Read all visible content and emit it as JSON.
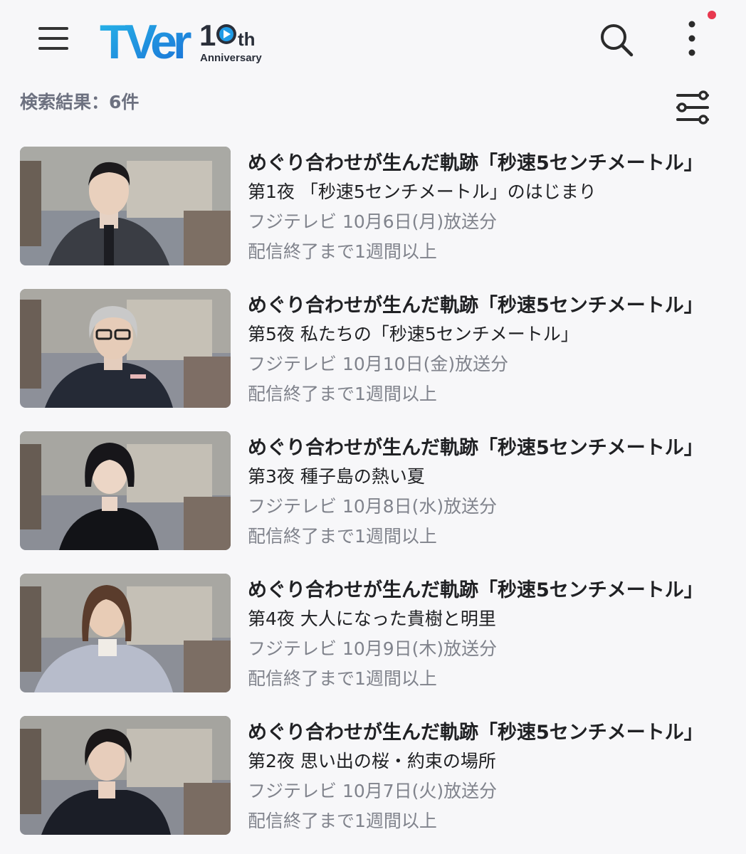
{
  "header": {
    "logo_text": "TVer",
    "logo_badge": "10th",
    "logo_anniversary": "Anniversary",
    "menu_icon": "hamburger-icon",
    "search_icon": "search-icon",
    "more_icon": "more-vertical-icon"
  },
  "results": {
    "count_label": "検索結果：6件",
    "filter_icon": "filter-sliders-icon"
  },
  "episodes": [
    {
      "title": "めぐり合わせが生んだ軌跡「秒速5センチメートル」",
      "subtitle": "第1夜 「秒速5センチメートル」のはじまり",
      "broadcast": "フジテレビ 10月6日(月)放送分",
      "availability": "配信終了まで1週間以上"
    },
    {
      "title": "めぐり合わせが生んだ軌跡「秒速5センチメートル」",
      "subtitle": "第5夜 私たちの「秒速5センチメートル」",
      "broadcast": "フジテレビ 10月10日(金)放送分",
      "availability": "配信終了まで1週間以上"
    },
    {
      "title": "めぐり合わせが生んだ軌跡「秒速5センチメートル」",
      "subtitle": "第3夜 種子島の熱い夏",
      "broadcast": "フジテレビ 10月8日(水)放送分",
      "availability": "配信終了まで1週間以上"
    },
    {
      "title": "めぐり合わせが生んだ軌跡「秒速5センチメートル」",
      "subtitle": "第4夜 大人になった貴樹と明里",
      "broadcast": "フジテレビ 10月9日(木)放送分",
      "availability": "配信終了まで1週間以上"
    },
    {
      "title": "めぐり合わせが生んだ軌跡「秒速5センチメートル」",
      "subtitle": "第2夜 思い出の桜・約束の場所",
      "broadcast": "フジテレビ 10月7日(火)放送分",
      "availability": "配信終了まで1週間以上"
    }
  ],
  "colors": {
    "logo_blue": "#1f9be6",
    "logo_dark": "#2a2f3a",
    "badge_red": "#e8384f",
    "meta_gray": "#80838c"
  }
}
